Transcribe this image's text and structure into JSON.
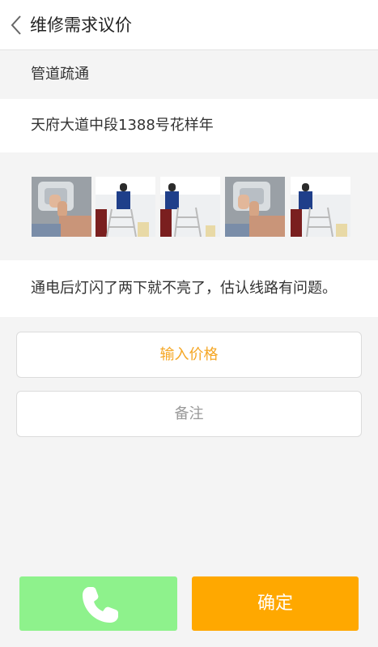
{
  "header": {
    "back_icon": "chevron-left-icon",
    "title": "维修需求议价"
  },
  "request": {
    "category": "管道疏通",
    "address": "天府大道中段1388号花样年",
    "description": "通电后灯闪了两下就不亮了，估认线路有问题。",
    "photos": [
      {
        "subject": "hands-on-ceiling-lamp"
      },
      {
        "subject": "worker-on-ladder"
      },
      {
        "subject": "worker-on-ladder"
      },
      {
        "subject": "hands-on-ceiling-lamp"
      },
      {
        "subject": "worker-on-ladder"
      }
    ]
  },
  "form": {
    "price_placeholder": "输入价格",
    "remark_placeholder": "备注"
  },
  "actions": {
    "call_icon": "phone-icon",
    "confirm_label": "确定"
  },
  "colors": {
    "accent": "#f5a623",
    "call_button": "#8ef28c",
    "confirm_button": "#ffa800"
  }
}
